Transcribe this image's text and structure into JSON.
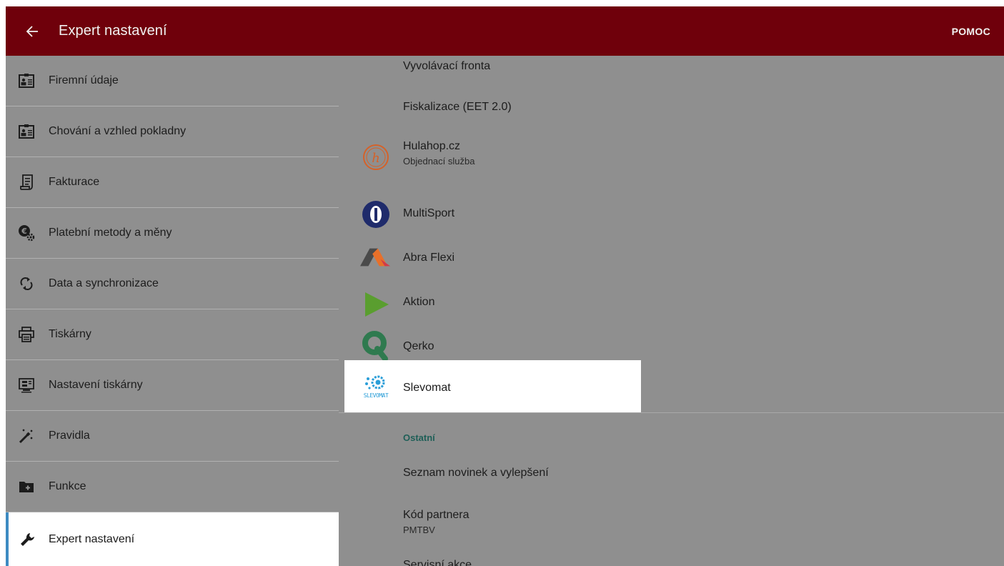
{
  "header": {
    "title": "Expert nastavení",
    "help_label": "POMOC",
    "back_icon": "arrow-left-icon",
    "bg_color": "#6f000b"
  },
  "sidebar": {
    "accent_color": "#3d8bc2",
    "items": [
      {
        "label": "Firemní údaje",
        "icon": "id-card-icon"
      },
      {
        "label": "Chování a vzhled pokladny",
        "icon": "id-card-icon"
      },
      {
        "label": "Fakturace",
        "icon": "invoice-icon"
      },
      {
        "label": "Platební metody a měny",
        "icon": "currency-settings-icon"
      },
      {
        "label": "Data a synchronizace",
        "icon": "sync-icon"
      },
      {
        "label": "Tiskárny",
        "icon": "printer-icon"
      },
      {
        "label": "Nastavení tiskárny",
        "icon": "printer-settings-icon"
      },
      {
        "label": "Pravidla",
        "icon": "magic-wand-icon"
      },
      {
        "label": "Funkce",
        "icon": "folder-plus-icon"
      },
      {
        "label": "Expert nastavení",
        "icon": "wrench-icon",
        "selected": true
      }
    ]
  },
  "main": {
    "items": [
      {
        "title": "Vyvolávací fronta"
      },
      {
        "title": "Fiskalizace (EET 2.0)"
      },
      {
        "title": "Hulahop.cz",
        "subtitle": "Objednací služba",
        "logo": "hulahop-logo"
      },
      {
        "title": "MultiSport",
        "logo": "multisport-logo"
      },
      {
        "title": "Abra Flexi",
        "logo": "abra-flexi-logo"
      },
      {
        "title": "Aktion",
        "logo": "aktion-logo"
      },
      {
        "title": "Qerko",
        "logo": "qerko-logo"
      },
      {
        "title": "Slevomat",
        "logo": "slevomat-logo",
        "logo_text": "SLEVOMAT",
        "highlighted": true
      }
    ],
    "section_other": {
      "header": "Ostatní",
      "items": [
        {
          "title": "Seznam novinek a vylepšení"
        },
        {
          "title": "Kód partnera",
          "subtitle": "PMTBV"
        },
        {
          "title": "Servisní akce"
        }
      ]
    }
  }
}
